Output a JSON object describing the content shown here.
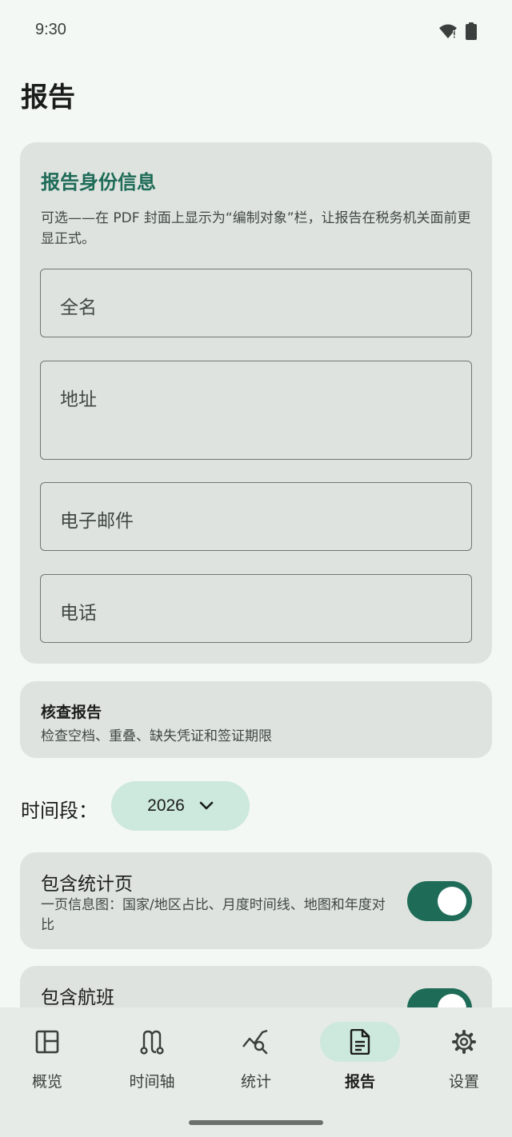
{
  "status": {
    "time": "9:30"
  },
  "page": {
    "title": "报告"
  },
  "identity": {
    "heading": "报告身份信息",
    "description": "可选——在 PDF 封面上显示为“编制对象”栏，让报告在税务机关面前更显正式。",
    "fields": {
      "full_name": "全名",
      "address": "地址",
      "email": "电子邮件",
      "phone": "电话"
    }
  },
  "check_report": {
    "title": "核查报告",
    "subtitle": "检查空档、重叠、缺失凭证和签证期限"
  },
  "period": {
    "label": "时间段：",
    "value": "2026"
  },
  "toggles": {
    "stats": {
      "title": "包含统计页",
      "subtitle": "一页信息图：国家/地区占比、月度时间线、地图和年度对比",
      "on": true
    },
    "flights": {
      "title": "包含航班",
      "on": true
    }
  },
  "nav": {
    "items": [
      {
        "label": "概览",
        "icon": "overview-icon"
      },
      {
        "label": "时间轴",
        "icon": "timeline-icon"
      },
      {
        "label": "统计",
        "icon": "stats-icon"
      },
      {
        "label": "报告",
        "icon": "report-icon",
        "active": true
      },
      {
        "label": "设置",
        "icon": "settings-icon"
      }
    ]
  },
  "colors": {
    "accent": "#1e6b57",
    "card": "#dee3df",
    "background": "#f3f8f4",
    "pill": "#cde8dd"
  }
}
